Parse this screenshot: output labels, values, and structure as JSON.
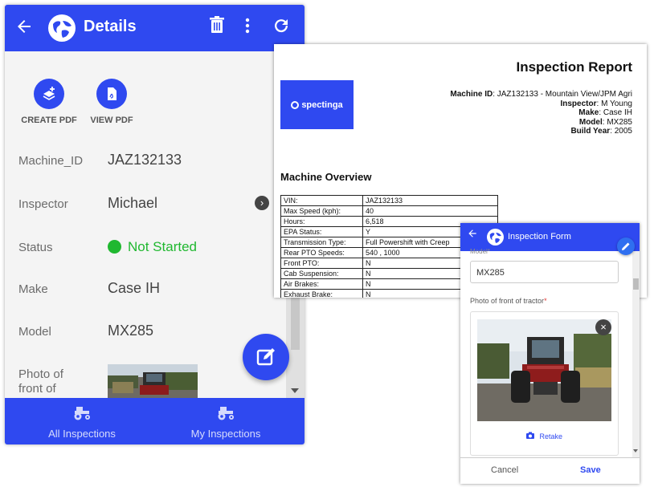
{
  "details": {
    "title": "Details",
    "icons": {
      "back": "back-arrow-icon",
      "logo": "globe-icon",
      "delete": "trash-icon",
      "more": "more-vertical-icon",
      "refresh": "refresh-icon"
    },
    "actions": [
      {
        "label": "CREATE PDF",
        "icon": "create-pdf-icon"
      },
      {
        "label": "VIEW PDF",
        "icon": "pdf-file-icon"
      }
    ],
    "fields": [
      {
        "label": "Machine_ID",
        "value": "JAZ132133"
      },
      {
        "label": "Inspector",
        "value": "Michael"
      },
      {
        "label": "Status",
        "value": "Not Started"
      },
      {
        "label": "Make",
        "value": "Case IH"
      },
      {
        "label": "Model",
        "value": "MX285"
      }
    ],
    "photo_label": "Photo of front of",
    "tabs": [
      {
        "label": "All Inspections",
        "icon": "tractor-icon"
      },
      {
        "label": "My Inspections",
        "icon": "tractor-icon"
      }
    ],
    "colors": {
      "primary": "#2f49f0",
      "status": "#20b830"
    }
  },
  "report": {
    "title": "Inspection Report",
    "logo_text": "spectinga",
    "info": [
      {
        "key": "Machine ID",
        "value": "JAZ132133 - Mountain View/JPM Agri"
      },
      {
        "key": "Inspector",
        "value": "M Young"
      },
      {
        "key": "Make",
        "value": "Case IH"
      },
      {
        "key": "Model",
        "value": "MX285"
      },
      {
        "key": "Build Year",
        "value": "2005"
      }
    ],
    "overview_title": "Machine Overview",
    "rows": [
      {
        "k": "VIN:",
        "v": "JAZ132133"
      },
      {
        "k": "Max Speed (kph):",
        "v": "40"
      },
      {
        "k": "Hours:",
        "v": "6,518"
      },
      {
        "k": "EPA Status:",
        "v": "Y"
      },
      {
        "k": "Transmission Type:",
        "v": "Full Powershift with Creep"
      },
      {
        "k": "Rear PTO Speeds:",
        "v": "540 , 1000"
      },
      {
        "k": "Front PTO:",
        "v": "N"
      },
      {
        "k": "Cab Suspension:",
        "v": "N"
      },
      {
        "k": "Air Brakes:",
        "v": "N"
      },
      {
        "k": "Exhaust Brake:",
        "v": "N"
      }
    ]
  },
  "form": {
    "title": "Inspection Form",
    "cut_label": "Model*",
    "model_value": "MX285",
    "photo_label": "Photo of front of tractor",
    "required_mark": "*",
    "retake": "Retake",
    "cancel": "Cancel",
    "save": "Save",
    "close_glyph": "×"
  }
}
